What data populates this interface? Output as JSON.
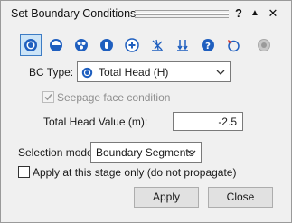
{
  "window": {
    "title": "Set Boundary Conditions",
    "help_label": "?",
    "collapse_label": "▲",
    "close_label": "✕"
  },
  "toolbar": {
    "items": [
      {
        "icon": "total-head-icon",
        "selected": true
      },
      {
        "icon": "pressure-head-icon",
        "selected": false
      },
      {
        "icon": "flow-icon",
        "selected": false
      },
      {
        "icon": "unknown-q0-icon",
        "selected": false
      },
      {
        "icon": "add-icon",
        "selected": false
      },
      {
        "icon": "infiltration-icon",
        "selected": false
      },
      {
        "icon": "drain-icon",
        "selected": false
      },
      {
        "icon": "help-icon",
        "selected": false
      },
      {
        "icon": "reset-icon",
        "selected": false
      },
      {
        "icon": "disabled-radio-icon",
        "selected": false
      }
    ]
  },
  "bc_type": {
    "label": "BC Type:",
    "value": "Total Head (H)"
  },
  "seepage": {
    "label": "Seepage face condition",
    "checked": true,
    "enabled": false
  },
  "total_head": {
    "label": "Total Head Value (m):",
    "value": "-2.5"
  },
  "selection_mode": {
    "label": "Selection mode:",
    "value": "Boundary Segments"
  },
  "stage_only": {
    "label": "Apply at this stage only (do not propagate)",
    "checked": false
  },
  "buttons": {
    "apply": "Apply",
    "close": "Close"
  },
  "colors": {
    "accent": "#1f5fbf",
    "selected_bg": "#cce4f7"
  }
}
